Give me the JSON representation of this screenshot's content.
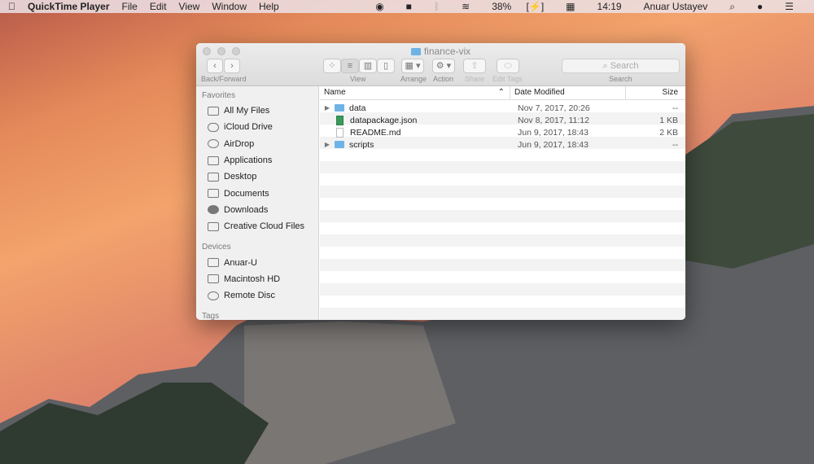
{
  "menubar": {
    "app": "QuickTime Player",
    "items": [
      "File",
      "Edit",
      "View",
      "Window",
      "Help"
    ],
    "battery": "38%",
    "clock": "14:19",
    "user": "Anuar Ustayev"
  },
  "window": {
    "title": "finance-vix",
    "toolbar": {
      "back_forward": "Back/Forward",
      "view": "View",
      "arrange": "Arrange",
      "action": "Action",
      "share": "Share",
      "edit_tags": "Edit Tags",
      "search_label": "Search",
      "search_placeholder": "Search"
    },
    "sidebar": {
      "favorites_header": "Favorites",
      "favorites": [
        "All My Files",
        "iCloud Drive",
        "AirDrop",
        "Applications",
        "Desktop",
        "Documents",
        "Downloads",
        "Creative Cloud Files"
      ],
      "devices_header": "Devices",
      "devices": [
        "Anuar-U",
        "Macintosh HD",
        "Remote Disc"
      ],
      "tags_header": "Tags"
    },
    "columns": {
      "name": "Name",
      "date": "Date Modified",
      "size": "Size"
    },
    "files": [
      {
        "name": "data",
        "date": "Nov 7, 2017, 20:26",
        "size": "--",
        "type": "folder"
      },
      {
        "name": "datapackage.json",
        "date": "Nov 8, 2017, 11:12",
        "size": "1 KB",
        "type": "json"
      },
      {
        "name": "README.md",
        "date": "Jun 9, 2017, 18:43",
        "size": "2 KB",
        "type": "doc"
      },
      {
        "name": "scripts",
        "date": "Jun 9, 2017, 18:43",
        "size": "--",
        "type": "folder"
      }
    ]
  }
}
